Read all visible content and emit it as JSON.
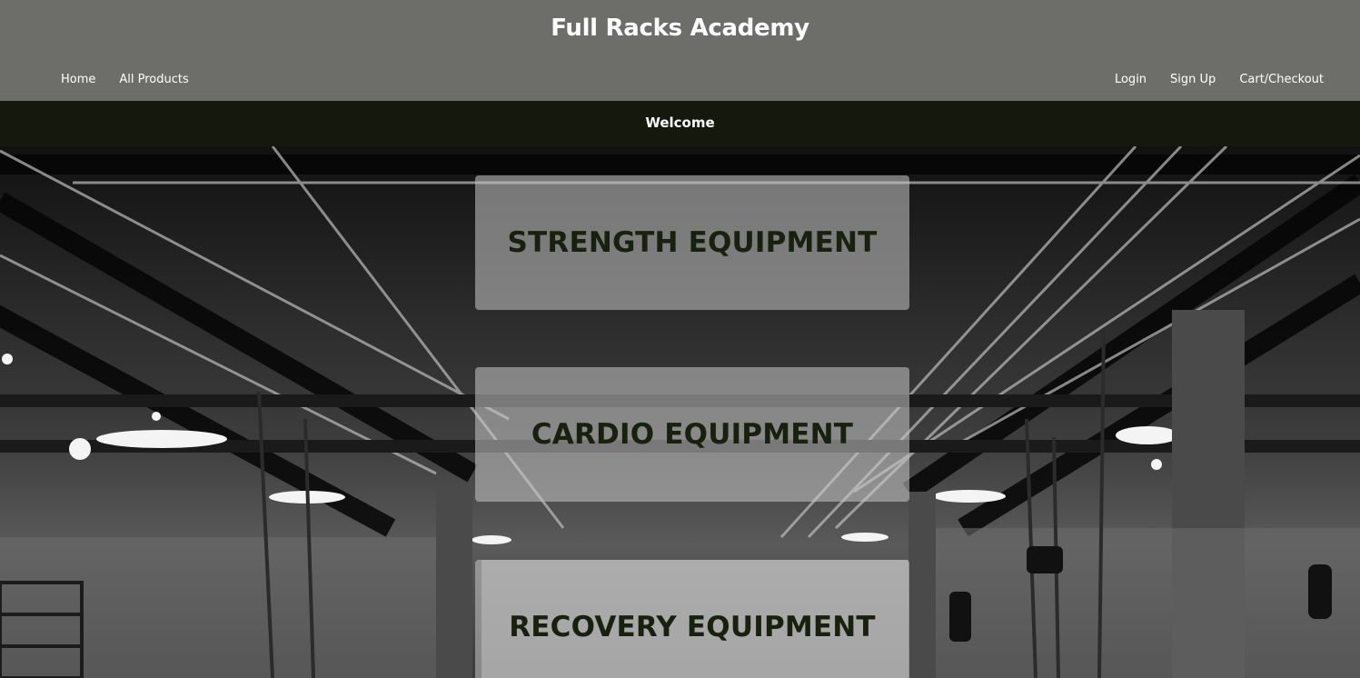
{
  "header": {
    "title": "Full Racks Academy",
    "nav_left": [
      {
        "label": "Home"
      },
      {
        "label": "All Products"
      }
    ],
    "nav_right": [
      {
        "label": "Login"
      },
      {
        "label": "Sign Up"
      },
      {
        "label": "Cart/Checkout"
      }
    ]
  },
  "banner": {
    "text": "Welcome"
  },
  "categories": [
    {
      "label": "STRENGTH EQUIPMENT"
    },
    {
      "label": "CARDIO EQUIPMENT"
    },
    {
      "label": "RECOVERY EQUIPMENT"
    }
  ],
  "colors": {
    "header_bg": "#6d6e69",
    "banner_bg": "#15180d",
    "card_text": "#17210d"
  }
}
